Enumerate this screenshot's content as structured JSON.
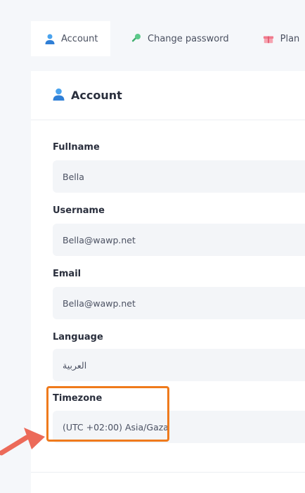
{
  "tabs": [
    {
      "label": "Account",
      "icon": "user-icon",
      "active": true
    },
    {
      "label": "Change password",
      "icon": "key-icon",
      "active": false
    },
    {
      "label": "Plan",
      "icon": "gift-box-icon",
      "active": false
    }
  ],
  "card": {
    "title": "Account",
    "icon": "user-icon"
  },
  "fields": {
    "fullname": {
      "label": "Fullname",
      "value": "Bella"
    },
    "username": {
      "label": "Username",
      "value": "Bella@wawp.net"
    },
    "email": {
      "label": "Email",
      "value": "Bella@wawp.net"
    },
    "language": {
      "label": "Language",
      "value": "العربية"
    },
    "timezone": {
      "label": "Timezone",
      "value": "(UTC +02:00) Asia/Gaza"
    }
  },
  "colors": {
    "accent_user": "#3a8fe0",
    "highlight": "#ef7a1c",
    "arrow": "#ec6a59"
  }
}
